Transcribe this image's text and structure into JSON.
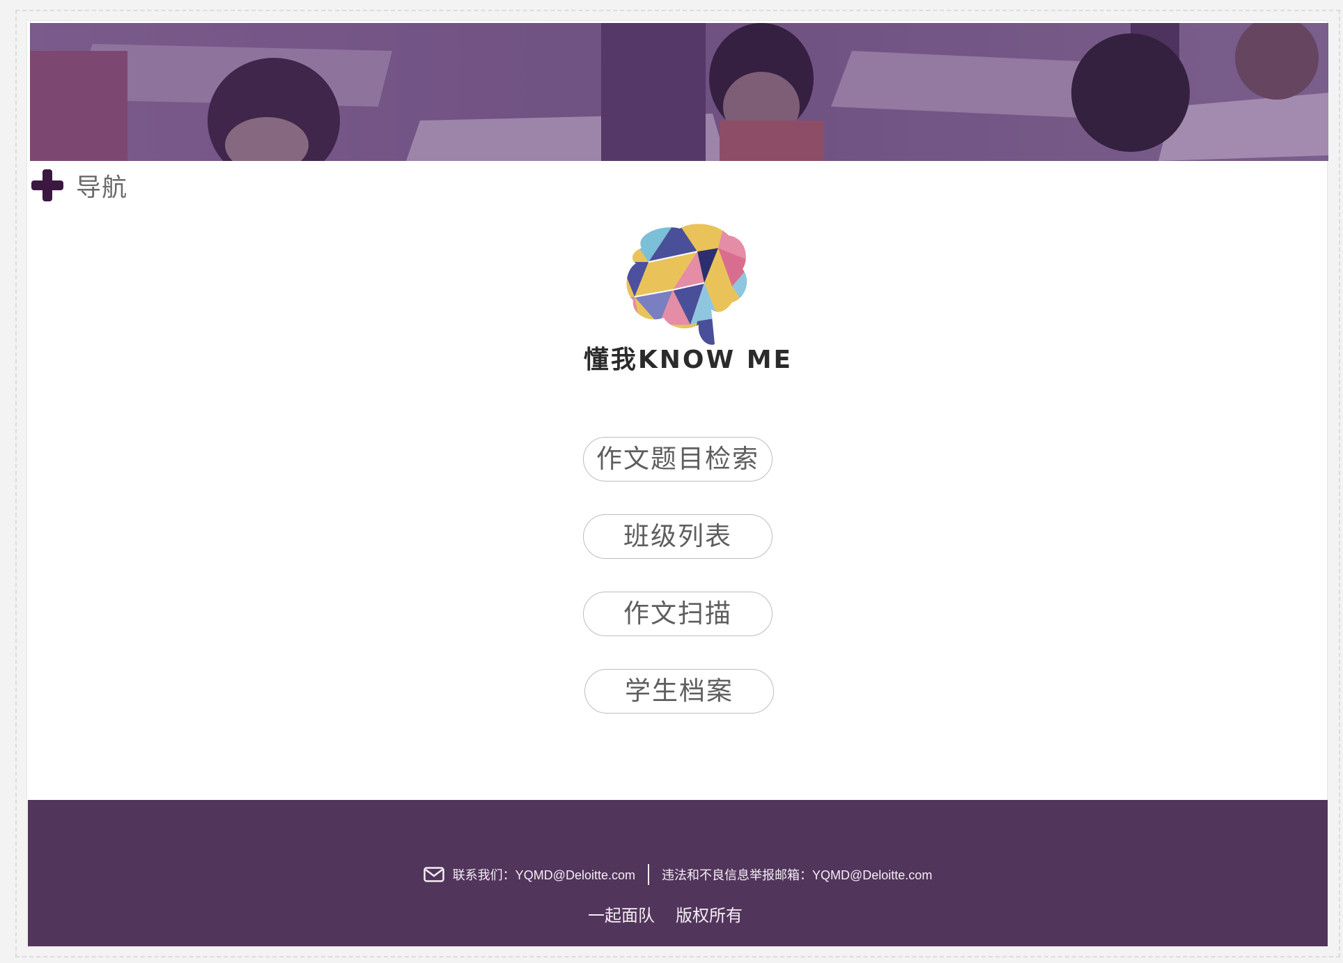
{
  "header": {
    "nav_label": "导航"
  },
  "brand": {
    "name": "懂我KNOW  ME"
  },
  "menu": {
    "items": [
      {
        "label": "作文题目检索"
      },
      {
        "label": "班级列表"
      },
      {
        "label": "作文扫描"
      },
      {
        "label": "学生档案"
      }
    ]
  },
  "footer": {
    "contact": "联系我们：YQMD@Deloitte.com",
    "report": "违法和不良信息举报邮箱：YQMD@Deloitte.com",
    "team": "一起面队",
    "rights": "版权所有"
  },
  "colors": {
    "footer_bg": "#52355b",
    "banner_tint": "#5d3f74",
    "plus_icon": "#3a1840"
  },
  "icons": {
    "nav": "plus-icon",
    "contact": "mail-icon",
    "logo": "brain-logo-icon"
  }
}
